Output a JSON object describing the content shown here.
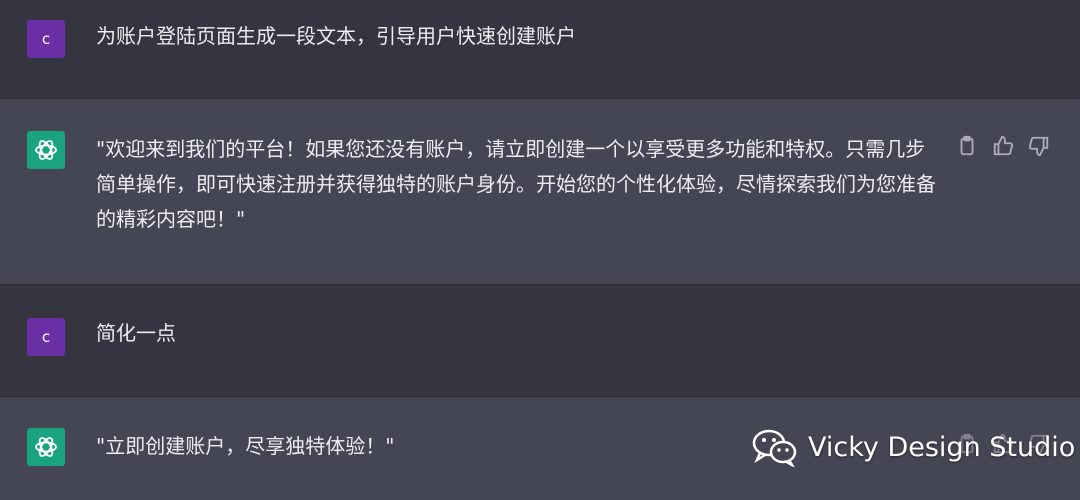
{
  "messages": [
    {
      "role": "user",
      "avatar": "c",
      "text": "为账户登陆页面生成一段文本，引导用户快速创建账户"
    },
    {
      "role": "assistant",
      "text": "\"欢迎来到我们的平台！如果您还没有账户，请立即创建一个以享受更多功能和特权。只需几步简单操作，即可快速注册并获得独特的账户身份。开始您的个性化体验，尽情探索我们为您准备的精彩内容吧！\""
    },
    {
      "role": "user",
      "avatar": "c",
      "text": "简化一点"
    },
    {
      "role": "assistant",
      "text": "\"立即创建账户，尽享独特体验！\""
    }
  ],
  "watermark": {
    "text": "Vicky Design Studio",
    "icon": "wechat-icon"
  },
  "colors": {
    "user_bg": "#343541",
    "assistant_bg": "#444654",
    "user_avatar": "#6b2fa5",
    "assistant_avatar": "#19a37f"
  }
}
